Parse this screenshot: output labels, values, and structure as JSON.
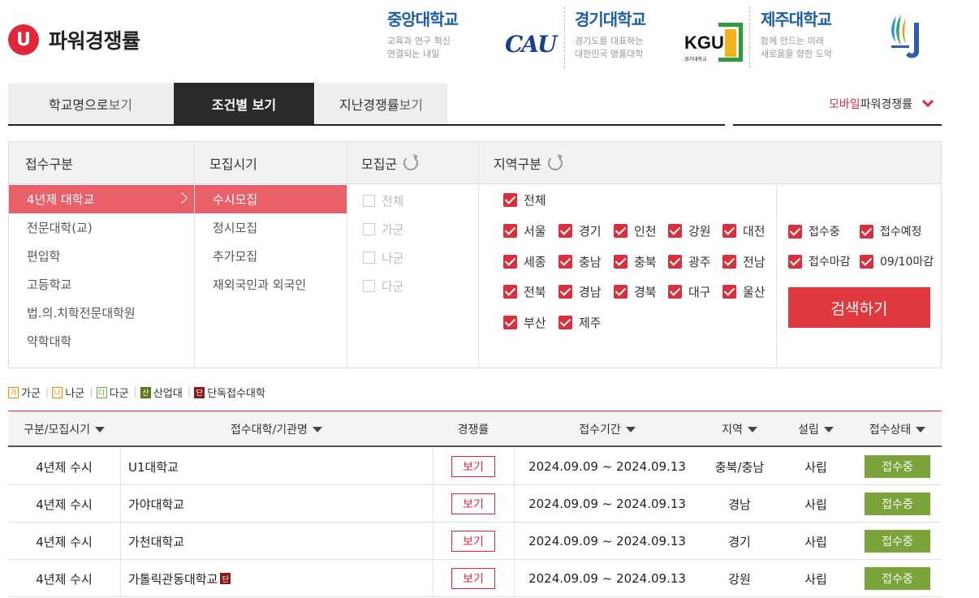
{
  "header": {
    "logo_letter": "U",
    "title": "파워경쟁률",
    "ads": [
      {
        "name": "중앙대학교",
        "line1": "교육과 연구 혁신",
        "line2": "연결되는 내일",
        "mark": "CAU"
      },
      {
        "name": "경기대학교",
        "line1": "경기도를 대표하는",
        "line2": "대한민국 명품대학",
        "mark": "KGU",
        "mark_small": "경기대학교"
      },
      {
        "name": "제주대학교",
        "line1": "함께 만드는 미래",
        "line2": "새로움을 향한 도약"
      }
    ]
  },
  "tabs": [
    {
      "label": "학교명으로 ",
      "label2": "보기"
    },
    {
      "label": "조건별 보기"
    },
    {
      "label": "지난경쟁률 ",
      "label2": "보기"
    }
  ],
  "mobile_link": {
    "red": "모바일 ",
    "label": "파워경쟁률"
  },
  "filter": {
    "headers": {
      "type": "접수구분",
      "period": "모집시기",
      "group": "모집군",
      "region": "지역구분"
    },
    "types": [
      "4년제 대학교",
      "전문대학(교)",
      "편입학",
      "고등학교",
      "법.의.치학전문대학원",
      "약학대학"
    ],
    "periods": [
      "수시모집",
      "정시모집",
      "추가모집",
      "재외국민과 외국인"
    ],
    "groups": [
      "전체",
      "가군",
      "나군",
      "다군"
    ],
    "region_all": "전체",
    "regions": [
      [
        "서울",
        "경기",
        "인천",
        "강원",
        "대전"
      ],
      [
        "세종",
        "충남",
        "충북",
        "광주",
        "전남"
      ],
      [
        "전북",
        "경남",
        "경북",
        "대구",
        "울산"
      ],
      [
        "부산",
        "제주"
      ]
    ],
    "statuses": [
      [
        "접수중",
        "접수예정"
      ],
      [
        "접수마감",
        "09/10마감"
      ]
    ],
    "search_button": "검색하기"
  },
  "legend": [
    {
      "icon": "가",
      "label": "가군",
      "color": "#f08a00"
    },
    {
      "icon": "나",
      "label": "나군",
      "color": "#f08a00"
    },
    {
      "icon": "다",
      "label": "다군",
      "color": "#6aa83a"
    },
    {
      "icon": "산",
      "label": "산업대",
      "color": "#5b7a1a"
    },
    {
      "icon": "단",
      "label": "단독접수대학",
      "color": "#8b1a1a"
    }
  ],
  "table": {
    "headers": [
      "구분/모집시기",
      "접수대학/기관명",
      "경쟁률",
      "접수기간",
      "지역",
      "설립",
      "접수상태"
    ],
    "rows": [
      {
        "type": "4년제 수시",
        "name": "U1대학교",
        "rate": "보기",
        "period": "2024.09.09 ~ 2024.09.13",
        "region": "충북/충남",
        "found": "사립",
        "status": "접수중",
        "dan": false
      },
      {
        "type": "4년제 수시",
        "name": "가야대학교",
        "rate": "보기",
        "period": "2024.09.09 ~ 2024.09.13",
        "region": "경남",
        "found": "사립",
        "status": "접수중",
        "dan": false
      },
      {
        "type": "4년제 수시",
        "name": "가천대학교",
        "rate": "보기",
        "period": "2024.09.09 ~ 2024.09.13",
        "region": "경기",
        "found": "사립",
        "status": "접수중",
        "dan": false
      },
      {
        "type": "4년제 수시",
        "name": "가톨릭관동대학교",
        "rate": "보기",
        "period": "2024.09.09 ~ 2024.09.13",
        "region": "강원",
        "found": "사립",
        "status": "접수중",
        "dan": true,
        "dan_icon": "단"
      }
    ]
  }
}
